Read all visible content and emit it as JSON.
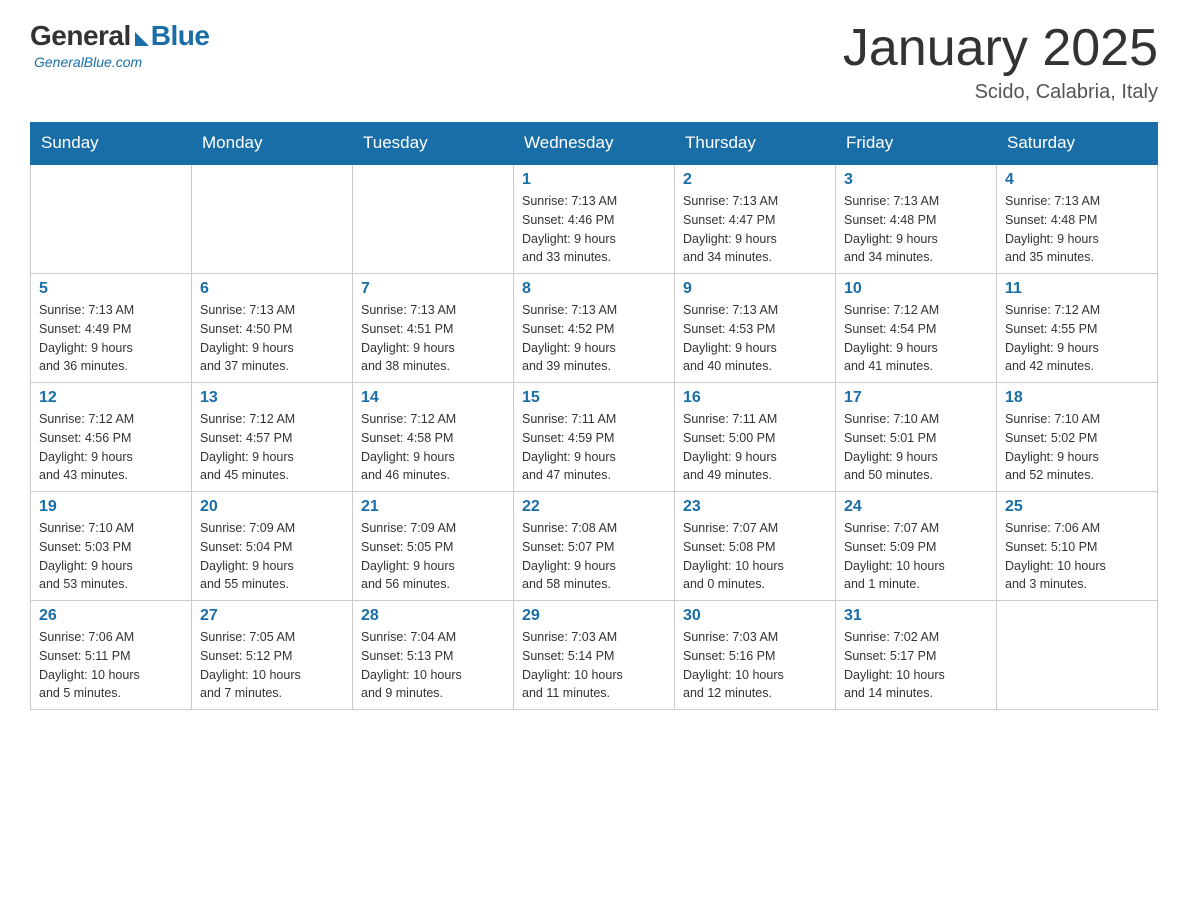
{
  "header": {
    "logo_general": "General",
    "logo_blue": "Blue",
    "logo_tagline": "GeneralBlue.com",
    "month_title": "January 2025",
    "location": "Scido, Calabria, Italy"
  },
  "weekdays": [
    "Sunday",
    "Monday",
    "Tuesday",
    "Wednesday",
    "Thursday",
    "Friday",
    "Saturday"
  ],
  "weeks": [
    [
      {
        "day": "",
        "info": ""
      },
      {
        "day": "",
        "info": ""
      },
      {
        "day": "",
        "info": ""
      },
      {
        "day": "1",
        "info": "Sunrise: 7:13 AM\nSunset: 4:46 PM\nDaylight: 9 hours\nand 33 minutes."
      },
      {
        "day": "2",
        "info": "Sunrise: 7:13 AM\nSunset: 4:47 PM\nDaylight: 9 hours\nand 34 minutes."
      },
      {
        "day": "3",
        "info": "Sunrise: 7:13 AM\nSunset: 4:48 PM\nDaylight: 9 hours\nand 34 minutes."
      },
      {
        "day": "4",
        "info": "Sunrise: 7:13 AM\nSunset: 4:48 PM\nDaylight: 9 hours\nand 35 minutes."
      }
    ],
    [
      {
        "day": "5",
        "info": "Sunrise: 7:13 AM\nSunset: 4:49 PM\nDaylight: 9 hours\nand 36 minutes."
      },
      {
        "day": "6",
        "info": "Sunrise: 7:13 AM\nSunset: 4:50 PM\nDaylight: 9 hours\nand 37 minutes."
      },
      {
        "day": "7",
        "info": "Sunrise: 7:13 AM\nSunset: 4:51 PM\nDaylight: 9 hours\nand 38 minutes."
      },
      {
        "day": "8",
        "info": "Sunrise: 7:13 AM\nSunset: 4:52 PM\nDaylight: 9 hours\nand 39 minutes."
      },
      {
        "day": "9",
        "info": "Sunrise: 7:13 AM\nSunset: 4:53 PM\nDaylight: 9 hours\nand 40 minutes."
      },
      {
        "day": "10",
        "info": "Sunrise: 7:12 AM\nSunset: 4:54 PM\nDaylight: 9 hours\nand 41 minutes."
      },
      {
        "day": "11",
        "info": "Sunrise: 7:12 AM\nSunset: 4:55 PM\nDaylight: 9 hours\nand 42 minutes."
      }
    ],
    [
      {
        "day": "12",
        "info": "Sunrise: 7:12 AM\nSunset: 4:56 PM\nDaylight: 9 hours\nand 43 minutes."
      },
      {
        "day": "13",
        "info": "Sunrise: 7:12 AM\nSunset: 4:57 PM\nDaylight: 9 hours\nand 45 minutes."
      },
      {
        "day": "14",
        "info": "Sunrise: 7:12 AM\nSunset: 4:58 PM\nDaylight: 9 hours\nand 46 minutes."
      },
      {
        "day": "15",
        "info": "Sunrise: 7:11 AM\nSunset: 4:59 PM\nDaylight: 9 hours\nand 47 minutes."
      },
      {
        "day": "16",
        "info": "Sunrise: 7:11 AM\nSunset: 5:00 PM\nDaylight: 9 hours\nand 49 minutes."
      },
      {
        "day": "17",
        "info": "Sunrise: 7:10 AM\nSunset: 5:01 PM\nDaylight: 9 hours\nand 50 minutes."
      },
      {
        "day": "18",
        "info": "Sunrise: 7:10 AM\nSunset: 5:02 PM\nDaylight: 9 hours\nand 52 minutes."
      }
    ],
    [
      {
        "day": "19",
        "info": "Sunrise: 7:10 AM\nSunset: 5:03 PM\nDaylight: 9 hours\nand 53 minutes."
      },
      {
        "day": "20",
        "info": "Sunrise: 7:09 AM\nSunset: 5:04 PM\nDaylight: 9 hours\nand 55 minutes."
      },
      {
        "day": "21",
        "info": "Sunrise: 7:09 AM\nSunset: 5:05 PM\nDaylight: 9 hours\nand 56 minutes."
      },
      {
        "day": "22",
        "info": "Sunrise: 7:08 AM\nSunset: 5:07 PM\nDaylight: 9 hours\nand 58 minutes."
      },
      {
        "day": "23",
        "info": "Sunrise: 7:07 AM\nSunset: 5:08 PM\nDaylight: 10 hours\nand 0 minutes."
      },
      {
        "day": "24",
        "info": "Sunrise: 7:07 AM\nSunset: 5:09 PM\nDaylight: 10 hours\nand 1 minute."
      },
      {
        "day": "25",
        "info": "Sunrise: 7:06 AM\nSunset: 5:10 PM\nDaylight: 10 hours\nand 3 minutes."
      }
    ],
    [
      {
        "day": "26",
        "info": "Sunrise: 7:06 AM\nSunset: 5:11 PM\nDaylight: 10 hours\nand 5 minutes."
      },
      {
        "day": "27",
        "info": "Sunrise: 7:05 AM\nSunset: 5:12 PM\nDaylight: 10 hours\nand 7 minutes."
      },
      {
        "day": "28",
        "info": "Sunrise: 7:04 AM\nSunset: 5:13 PM\nDaylight: 10 hours\nand 9 minutes."
      },
      {
        "day": "29",
        "info": "Sunrise: 7:03 AM\nSunset: 5:14 PM\nDaylight: 10 hours\nand 11 minutes."
      },
      {
        "day": "30",
        "info": "Sunrise: 7:03 AM\nSunset: 5:16 PM\nDaylight: 10 hours\nand 12 minutes."
      },
      {
        "day": "31",
        "info": "Sunrise: 7:02 AM\nSunset: 5:17 PM\nDaylight: 10 hours\nand 14 minutes."
      },
      {
        "day": "",
        "info": ""
      }
    ]
  ]
}
